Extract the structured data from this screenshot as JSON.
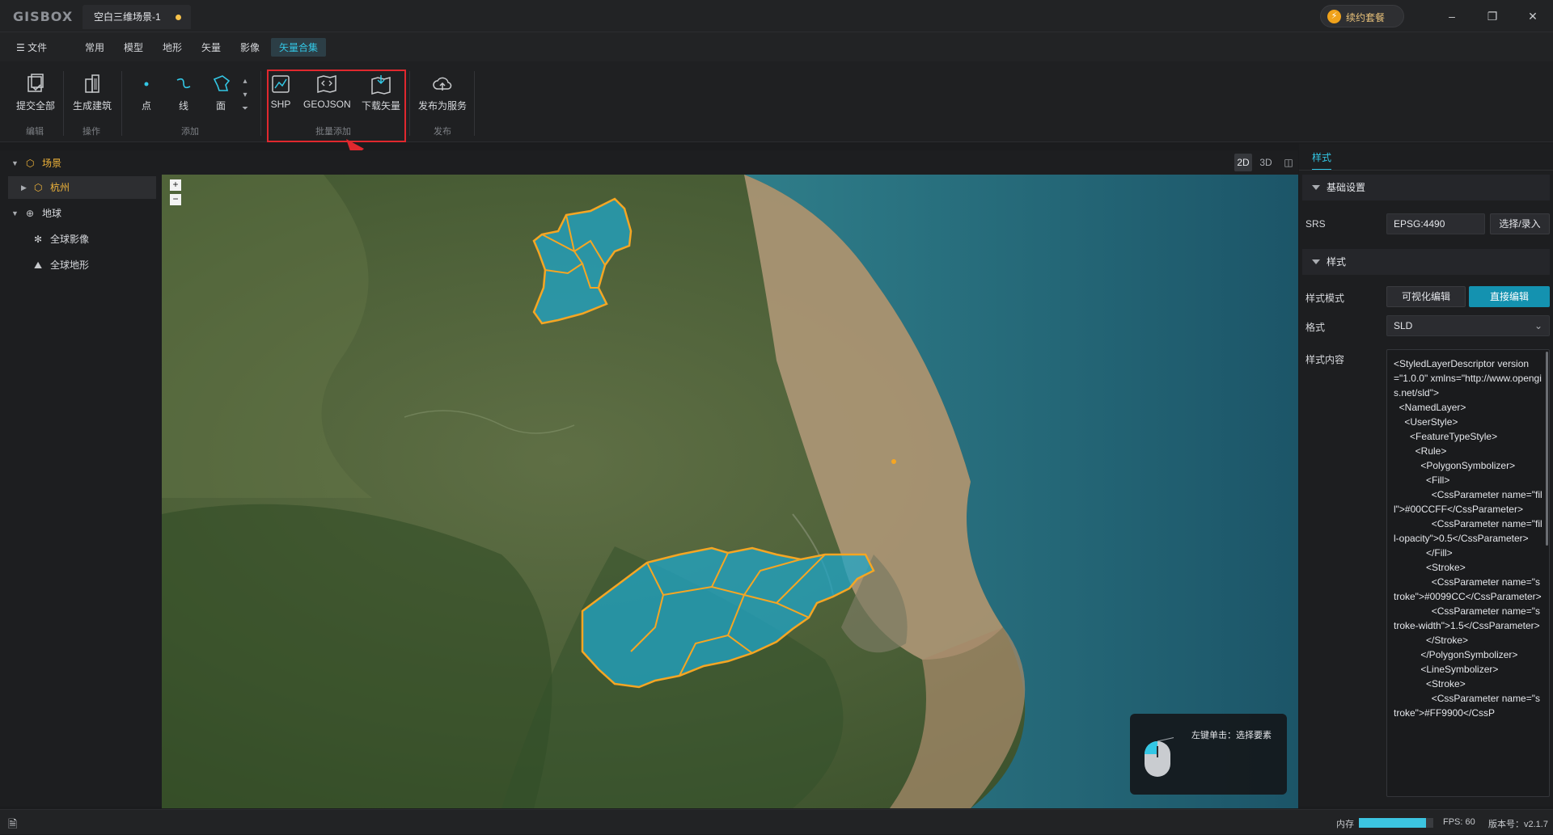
{
  "app": {
    "logo": "GISBOX",
    "doc_tab": "空白三维场景-1",
    "renew_label": "续约套餐",
    "window": {
      "minimize": "–",
      "restore": "❐",
      "close": "✕"
    }
  },
  "menu": {
    "file": "文件",
    "items": [
      "常用",
      "模型",
      "地形",
      "矢量",
      "影像",
      "矢量合集"
    ],
    "active_index": 5
  },
  "ribbon": {
    "tools": {
      "submit_all": "提交全部",
      "gen_building": "生成建筑",
      "point": "点",
      "line": "线",
      "polygon": "面",
      "shp": "SHP",
      "geojson": "GEOJSON",
      "download_vector": "下载矢量",
      "publish_service": "发布为服务"
    },
    "groups": {
      "edit": "编辑",
      "operate": "操作",
      "add": "添加",
      "batch_add": "批量添加",
      "publish": "发布"
    }
  },
  "tree": {
    "scene": "场景",
    "hangzhou": "杭州",
    "earth": "地球",
    "global_imagery": "全球影像",
    "global_terrain": "全球地形"
  },
  "map": {
    "view_2d": "2D",
    "view_3d": "3D",
    "zoom_in": "+",
    "zoom_out": "−",
    "tip_text": "左键单击：选择要素"
  },
  "right_panel": {
    "tab": "样式",
    "basic_settings": "基础设置",
    "srs_label": "SRS",
    "srs_value": "EPSG:4490",
    "select_btn": "选择/录入",
    "style_section": "样式",
    "style_mode_label": "样式模式",
    "visual_edit": "可视化编辑",
    "direct_edit": "直接编辑",
    "format_label": "格式",
    "format_value": "SLD",
    "content_label": "样式内容",
    "content": "<StyledLayerDescriptor version=\"1.0.0\" xmlns=\"http://www.opengis.net/sld\">\n  <NamedLayer>\n    <UserStyle>\n      <FeatureTypeStyle>\n        <Rule>\n          <PolygonSymbolizer>\n            <Fill>\n              <CssParameter name=\"fill\">#00CCFF</CssParameter>\n              <CssParameter name=\"fill-opacity\">0.5</CssParameter>\n            </Fill>\n            <Stroke>\n              <CssParameter name=\"stroke\">#0099CC</CssParameter>\n              <CssParameter name=\"stroke-width\">1.5</CssParameter>\n            </Stroke>\n          </PolygonSymbolizer>\n          <LineSymbolizer>\n            <Stroke>\n              <CssParameter name=\"stroke\">#FF9900</CssP"
  },
  "status": {
    "memory_label": "内存",
    "memory_fraction": 0.9,
    "fps": "FPS: 60",
    "version": "版本号：v2.1.7"
  },
  "colors": {
    "accent": "#33c7e5",
    "highlight_box": "#e0282e",
    "polygon_fill": "#1fa6c8",
    "polygon_stroke": "#f5a623"
  }
}
